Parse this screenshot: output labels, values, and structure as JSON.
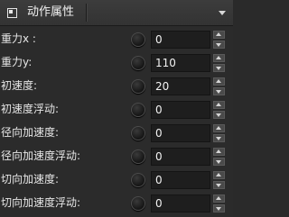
{
  "panel": {
    "title": "动作属性",
    "icon": "panel-icon",
    "menu_icon": "chevron-down-icon"
  },
  "rows": [
    {
      "label": "重力x :",
      "value": "0"
    },
    {
      "label": "重力y:",
      "value": "110"
    },
    {
      "label": "初速度:",
      "value": "20"
    },
    {
      "label": "初速度浮动:",
      "value": "0"
    },
    {
      "label": "径向加速度:",
      "value": "0"
    },
    {
      "label": "径向加速度浮动:",
      "value": "0"
    },
    {
      "label": "切向加速度:",
      "value": "0"
    },
    {
      "label": "切向加速度浮动:",
      "value": "0"
    }
  ]
}
